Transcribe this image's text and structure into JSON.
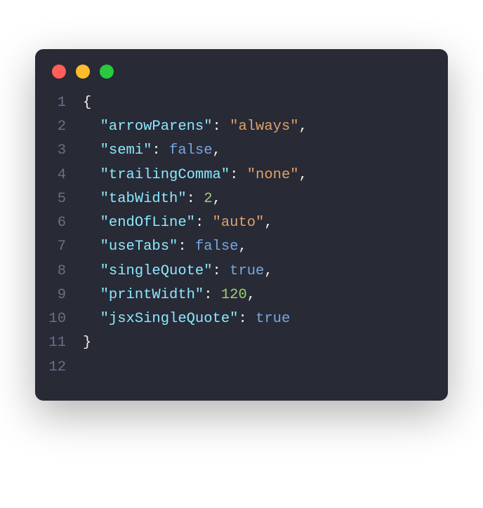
{
  "lines": [
    {
      "num": "1",
      "tokens": [
        {
          "t": "{",
          "c": "punct"
        }
      ]
    },
    {
      "num": "2",
      "tokens": [
        {
          "t": "  ",
          "c": ""
        },
        {
          "t": "\"arrowParens\"",
          "c": "key"
        },
        {
          "t": ": ",
          "c": "punct"
        },
        {
          "t": "\"always\"",
          "c": "string"
        },
        {
          "t": ",",
          "c": "punct"
        }
      ]
    },
    {
      "num": "3",
      "tokens": [
        {
          "t": "  ",
          "c": ""
        },
        {
          "t": "\"semi\"",
          "c": "key"
        },
        {
          "t": ": ",
          "c": "punct"
        },
        {
          "t": "false",
          "c": "boolean"
        },
        {
          "t": ",",
          "c": "punct"
        }
      ]
    },
    {
      "num": "4",
      "tokens": [
        {
          "t": "  ",
          "c": ""
        },
        {
          "t": "\"trailingComma\"",
          "c": "key"
        },
        {
          "t": ": ",
          "c": "punct"
        },
        {
          "t": "\"none\"",
          "c": "string"
        },
        {
          "t": ",",
          "c": "punct"
        }
      ]
    },
    {
      "num": "5",
      "tokens": [
        {
          "t": "  ",
          "c": ""
        },
        {
          "t": "\"tabWidth\"",
          "c": "key"
        },
        {
          "t": ": ",
          "c": "punct"
        },
        {
          "t": "2",
          "c": "number"
        },
        {
          "t": ",",
          "c": "punct"
        }
      ]
    },
    {
      "num": "6",
      "tokens": [
        {
          "t": "  ",
          "c": ""
        },
        {
          "t": "\"endOfLine\"",
          "c": "key"
        },
        {
          "t": ": ",
          "c": "punct"
        },
        {
          "t": "\"auto\"",
          "c": "string"
        },
        {
          "t": ",",
          "c": "punct"
        }
      ]
    },
    {
      "num": "7",
      "tokens": [
        {
          "t": "  ",
          "c": ""
        },
        {
          "t": "\"useTabs\"",
          "c": "key"
        },
        {
          "t": ": ",
          "c": "punct"
        },
        {
          "t": "false",
          "c": "boolean"
        },
        {
          "t": ",",
          "c": "punct"
        }
      ]
    },
    {
      "num": "8",
      "tokens": [
        {
          "t": "  ",
          "c": ""
        },
        {
          "t": "\"singleQuote\"",
          "c": "key"
        },
        {
          "t": ": ",
          "c": "punct"
        },
        {
          "t": "true",
          "c": "boolean"
        },
        {
          "t": ",",
          "c": "punct"
        }
      ]
    },
    {
      "num": "9",
      "tokens": [
        {
          "t": "  ",
          "c": ""
        },
        {
          "t": "\"printWidth\"",
          "c": "key"
        },
        {
          "t": ": ",
          "c": "punct"
        },
        {
          "t": "120",
          "c": "number"
        },
        {
          "t": ",",
          "c": "punct"
        }
      ]
    },
    {
      "num": "10",
      "tokens": [
        {
          "t": "  ",
          "c": ""
        },
        {
          "t": "\"jsxSingleQuote\"",
          "c": "key"
        },
        {
          "t": ": ",
          "c": "punct"
        },
        {
          "t": "true",
          "c": "boolean"
        }
      ]
    },
    {
      "num": "11",
      "tokens": [
        {
          "t": "}",
          "c": "punct"
        }
      ]
    },
    {
      "num": "12",
      "tokens": []
    }
  ]
}
